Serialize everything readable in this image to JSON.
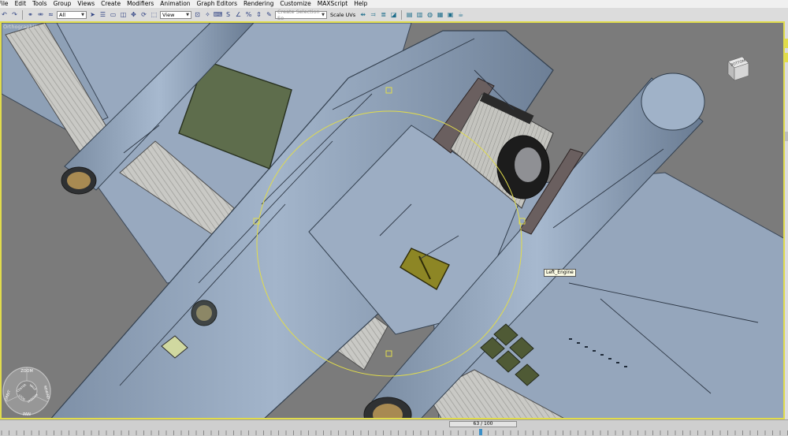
{
  "menubar": {
    "items": [
      "File",
      "Edit",
      "Tools",
      "Group",
      "Views",
      "Create",
      "Modifiers",
      "Animation",
      "Graph Editors",
      "Rendering",
      "Customize",
      "MAXScript",
      "Help"
    ]
  },
  "toolbar": {
    "filter_select": "All",
    "coord_select": "View",
    "selection_set_placeholder": "Create Selection Se",
    "scale_uvs_label": "Scale UVs"
  },
  "viewport": {
    "label": "Orthographic",
    "tooltip": "Left_Engine",
    "viewcube_face": "BOTTOM",
    "steering_wheel": {
      "zoom": "ZOOM",
      "orbit": "ORBIT",
      "rewind": "REWIND",
      "pan": "PAN",
      "center": "CENTER",
      "walk": "WALK",
      "look": "LOOK",
      "up_down": "UP/DOWN"
    },
    "selection_color": "#e1dc4c",
    "background_color": "#7b7b7b"
  },
  "timeline": {
    "frame_readout": "63 / 100",
    "current_frame": 63,
    "total_frames": 100
  }
}
